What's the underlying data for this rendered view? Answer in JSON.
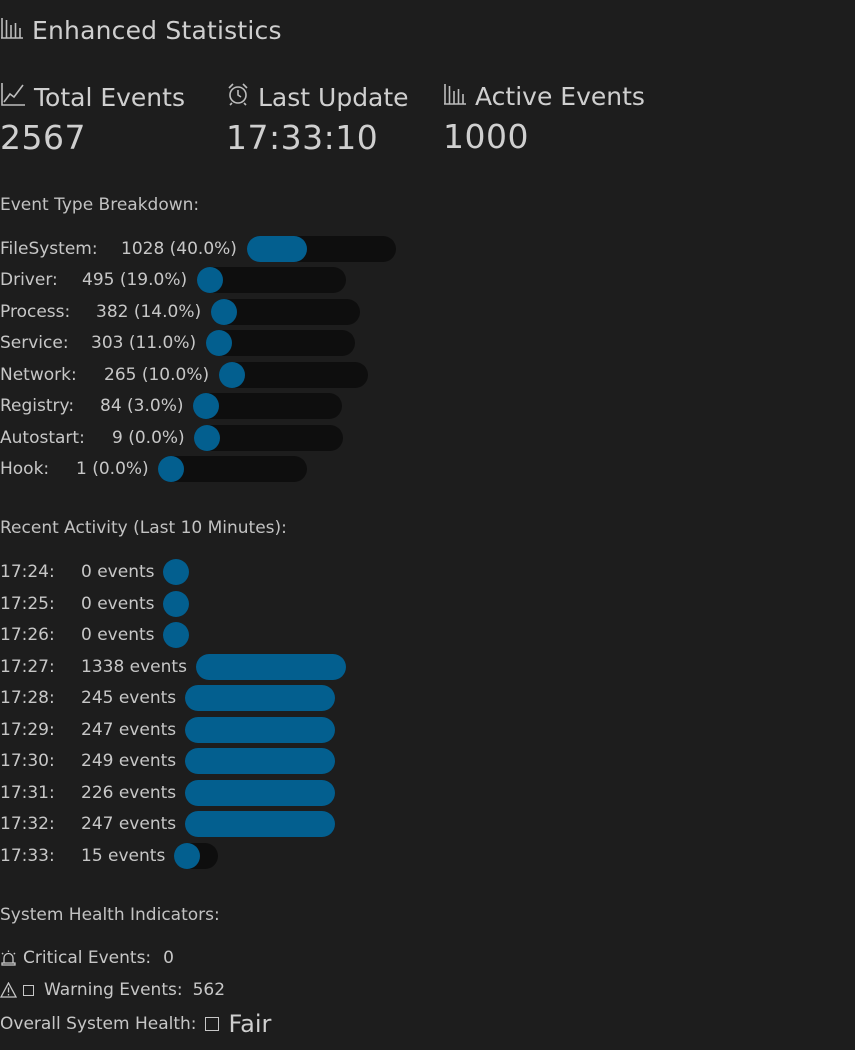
{
  "title": "Enhanced Statistics",
  "metrics": {
    "total_events": {
      "label": "Total Events",
      "value": "2567"
    },
    "last_update": {
      "label": "Last Update",
      "value": "17:33:10"
    },
    "active_events": {
      "label": "Active Events",
      "value": "1000"
    }
  },
  "breakdown": {
    "heading": "Event Type Breakdown:",
    "items": [
      {
        "label": "FileSystem:",
        "count": "1028 (40.0%)",
        "fraction": 0.4
      },
      {
        "label": "Driver:",
        "count": "495 (19.0%)",
        "fraction": 0.0
      },
      {
        "label": "Process:",
        "count": "382 (14.0%)",
        "fraction": 0.0
      },
      {
        "label": "Service:",
        "count": "303 (11.0%)",
        "fraction": 0.0
      },
      {
        "label": "Network:",
        "count": "265 (10.0%)",
        "fraction": 0.0
      },
      {
        "label": "Registry:",
        "count": "84 (3.0%)",
        "fraction": 0.0
      },
      {
        "label": "Autostart:",
        "count": "9 (0.0%)",
        "fraction": 0.0
      },
      {
        "label": "Hook:",
        "count": "1 (0.0%)",
        "fraction": 0.0
      }
    ]
  },
  "activity": {
    "heading": "Recent Activity (Last 10 Minutes):",
    "items": [
      {
        "time": "17:24:",
        "count": "0 events",
        "fraction": 0.0
      },
      {
        "time": "17:25:",
        "count": "0 events",
        "fraction": 0.0
      },
      {
        "time": "17:26:",
        "count": "0 events",
        "fraction": 0.0
      },
      {
        "time": "17:27:",
        "count": "1338 events",
        "fraction": 1.0
      },
      {
        "time": "17:28:",
        "count": "245 events",
        "fraction": 1.0
      },
      {
        "time": "17:29:",
        "count": "247 events",
        "fraction": 1.0
      },
      {
        "time": "17:30:",
        "count": "249 events",
        "fraction": 1.0
      },
      {
        "time": "17:31:",
        "count": "226 events",
        "fraction": 1.0
      },
      {
        "time": "17:32:",
        "count": "247 events",
        "fraction": 1.0
      },
      {
        "time": "17:33:",
        "count": "15 events",
        "fraction": 0.0
      }
    ]
  },
  "health": {
    "heading": "System Health Indicators:",
    "critical": {
      "label": "Critical Events:",
      "value": "0"
    },
    "warning": {
      "label": "Warning Events:",
      "value": "562"
    },
    "overall": {
      "label": "Overall System Health:",
      "value": "Fair"
    }
  },
  "colors": {
    "accent": "#035f8f",
    "track": "#0e0e0e",
    "background": "#1d1d1d"
  }
}
